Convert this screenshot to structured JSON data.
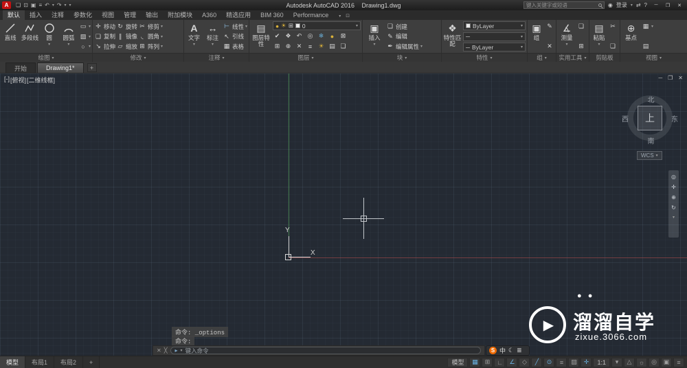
{
  "title_bar": {
    "app_logo": "A",
    "title": "Autodesk AutoCAD 2016",
    "doc_name": "Drawing1.dwg",
    "search_placeholder": "键入关键字或短语",
    "signin_label": "登录"
  },
  "ribbon_tabs": [
    "默认",
    "插入",
    "注释",
    "参数化",
    "视图",
    "管理",
    "输出",
    "附加模块",
    "A360",
    "精选应用",
    "BIM 360",
    "Performance"
  ],
  "active_tab": "默认",
  "ribbon": {
    "draw": {
      "label": "绘图",
      "line": "直线",
      "polyline": "多段线",
      "circle": "圆",
      "arc": "圆弧"
    },
    "modify": {
      "label": "修改",
      "move": "移动",
      "rotate": "旋转",
      "trim": "修剪",
      "copy": "复制",
      "mirror": "镜像",
      "fillet": "圆角",
      "stretch": "拉伸",
      "scale": "缩放",
      "array": "阵列"
    },
    "annotation": {
      "label": "注释",
      "text": "文字",
      "dimension": "标注",
      "linear": "线性",
      "leader": "引线",
      "table": "表格"
    },
    "layers": {
      "label": "图层",
      "layer_properties": "图层特性",
      "current_layer": "0"
    },
    "block": {
      "label": "块",
      "insert": "插入",
      "create": "创建",
      "edit": "编辑",
      "edit_attribute": "编辑属性"
    },
    "properties": {
      "label": "特性",
      "match_props": "特性匹配",
      "color_value": "ByLayer",
      "linetype_value": "ByLayer"
    },
    "groups": {
      "label": "组",
      "group": "组"
    },
    "utilities": {
      "label": "实用工具",
      "measure": "测量"
    },
    "clipboard": {
      "label": "剪贴板",
      "paste": "粘贴"
    },
    "view": {
      "label": "视图",
      "base": "基点"
    }
  },
  "file_tabs": {
    "start": "开始",
    "drawing": "Drawing1*",
    "add": "+"
  },
  "canvas": {
    "viewport_minus": "[-]",
    "viewport_view": "[俯视]",
    "viewport_style": "[二维线框]",
    "viewcube": {
      "n": "北",
      "s": "南",
      "e": "东",
      "w": "西",
      "top": "上",
      "wcs": "WCS"
    },
    "ucs_x": "X",
    "ucs_y": "Y",
    "cmd_line1": "命令: _options",
    "cmd_line2": "命令:",
    "watermark_title": "溜溜自学",
    "watermark_url": "zixue.3066.com"
  },
  "command_bar": {
    "placeholder": "键入命令"
  },
  "ime": {
    "logo": "S",
    "lang": "中"
  },
  "status_bar": {
    "tabs": [
      "模型",
      "布局1",
      "布局2",
      "+"
    ],
    "model": "模型",
    "scale": "1:1"
  },
  "icons": {
    "new": "❏",
    "open": "⊡",
    "save": "▣",
    "plot": "≡",
    "undo": "↶",
    "redo": "↷",
    "caret": "▾",
    "signin": "◉",
    "exchange": "⇄",
    "help": "?",
    "min": "─",
    "max": "❐",
    "close": "✕",
    "rect": "▭",
    "hatch": "▨",
    "ellipse": "○",
    "move": "✛",
    "rotate": "↻",
    "trim": "✂",
    "copy": "❏",
    "mirror": "∥",
    "fillet": "◟",
    "stretch": "↘",
    "scale": "▱",
    "array": "⊞",
    "text": "A",
    "dimension": "↔",
    "linear": "⊢",
    "leader": "↖",
    "table": "▦",
    "layer_props": "▤",
    "bulb": "●",
    "sun": "☀",
    "freeze": "❄",
    "check": "✔",
    "match": "❖",
    "prev": "↶",
    "isolate": "◎",
    "lock": "⊠",
    "unlock": "⊞",
    "merge": "⊕",
    "delete": "✕",
    "list": "≡",
    "states": "▤",
    "insert": "▣",
    "create": "❏",
    "edit": "✎",
    "edit_attr": "✒",
    "linetype": "─",
    "group": "▣",
    "measure": "∡",
    "quick_select": "❏",
    "calculator": "⊞",
    "paste": "▤",
    "cut": "✂",
    "base": "⊕",
    "viewport": "▦",
    "wheel": "◎",
    "pan": "✛",
    "zoom": "⊕",
    "orbit": "↻",
    "dots": "● ●",
    "play": "▶",
    "wrench": "╳",
    "prompt": "▸",
    "grid": "▦",
    "snap": "⊞",
    "ortho": "∟",
    "polar": "∠",
    "iso": "◇",
    "otrack": "╱",
    "osnap": "⊙",
    "lwt": "≡",
    "transparency": "▨",
    "dyn": "✛",
    "annotation": "△",
    "gear": "☼",
    "isolate_obj": "◎",
    "clean": "▣",
    "customize": "≡",
    "moon": "☾",
    "menu": "≣"
  }
}
